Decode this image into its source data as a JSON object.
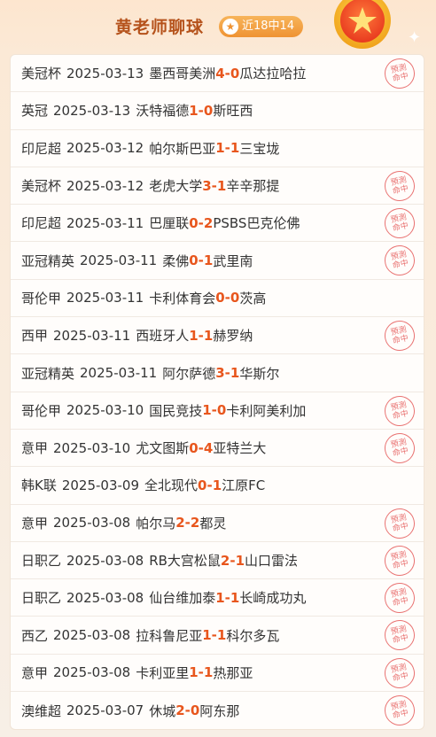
{
  "header": {
    "title": "黄老师聊球",
    "record": "近18中14"
  },
  "stamp_text": {
    "line1": "預測",
    "line2": "命中"
  },
  "matches": [
    {
      "league": "美冠杯",
      "date": "2025-03-13",
      "home": "墨西哥美洲",
      "home_score": "4",
      "away_score": "0",
      "away": "瓜达拉哈拉",
      "hit": true
    },
    {
      "league": "英冠",
      "date": "2025-03-13",
      "home": "沃特福德",
      "home_score": "1",
      "away_score": "0",
      "away": "斯旺西",
      "hit": false
    },
    {
      "league": "印尼超",
      "date": "2025-03-12",
      "home": "帕尔斯巴亚",
      "home_score": "1",
      "away_score": "1",
      "away": "三宝垅",
      "hit": false
    },
    {
      "league": "美冠杯",
      "date": "2025-03-12",
      "home": "老虎大学",
      "home_score": "3",
      "away_score": "1",
      "away": "辛辛那提",
      "hit": true
    },
    {
      "league": "印尼超",
      "date": "2025-03-11",
      "home": "巴厘联",
      "home_score": "0",
      "away_score": "2",
      "away": "PSBS巴克伦佛",
      "hit": true
    },
    {
      "league": "亚冠精英",
      "date": "2025-03-11",
      "home": "柔佛",
      "home_score": "0",
      "away_score": "1",
      "away": "武里南",
      "hit": true
    },
    {
      "league": "哥伦甲",
      "date": "2025-03-11",
      "home": "卡利体育会",
      "home_score": "0",
      "away_score": "0",
      "away": "茨高",
      "hit": false
    },
    {
      "league": "西甲",
      "date": "2025-03-11",
      "home": "西班牙人",
      "home_score": "1",
      "away_score": "1",
      "away": "赫罗纳",
      "hit": true
    },
    {
      "league": "亚冠精英",
      "date": "2025-03-11",
      "home": "阿尔萨德",
      "home_score": "3",
      "away_score": "1",
      "away": "华斯尔",
      "hit": false
    },
    {
      "league": "哥伦甲",
      "date": "2025-03-10",
      "home": "国民竞技",
      "home_score": "1",
      "away_score": "0",
      "away": "卡利阿美利加",
      "hit": true
    },
    {
      "league": "意甲",
      "date": "2025-03-10",
      "home": "尤文图斯",
      "home_score": "0",
      "away_score": "4",
      "away": "亚特兰大",
      "hit": true
    },
    {
      "league": "韩K联",
      "date": "2025-03-09",
      "home": "全北现代",
      "home_score": "0",
      "away_score": "1",
      "away": "江原FC",
      "hit": false
    },
    {
      "league": "意甲",
      "date": "2025-03-08",
      "home": "帕尔马",
      "home_score": "2",
      "away_score": "2",
      "away": "都灵",
      "hit": true
    },
    {
      "league": "日职乙",
      "date": "2025-03-08",
      "home": "RB大宫松鼠",
      "home_score": "2",
      "away_score": "1",
      "away": "山口雷法",
      "hit": true
    },
    {
      "league": "日职乙",
      "date": "2025-03-08",
      "home": "仙台维加泰",
      "home_score": "1",
      "away_score": "1",
      "away": "长崎成功丸",
      "hit": true
    },
    {
      "league": "西乙",
      "date": "2025-03-08",
      "home": "拉科鲁尼亚",
      "home_score": "1",
      "away_score": "1",
      "away": "科尔多瓦",
      "hit": true
    },
    {
      "league": "意甲",
      "date": "2025-03-08",
      "home": "卡利亚里",
      "home_score": "1",
      "away_score": "1",
      "away": "热那亚",
      "hit": true
    },
    {
      "league": "澳维超",
      "date": "2025-03-07",
      "home": "休城",
      "home_score": "2",
      "away_score": "0",
      "away": "阿东那",
      "hit": true
    }
  ],
  "colors": {
    "accent": "#e8561d",
    "title": "#b5521b",
    "stamp": "#e24545"
  }
}
